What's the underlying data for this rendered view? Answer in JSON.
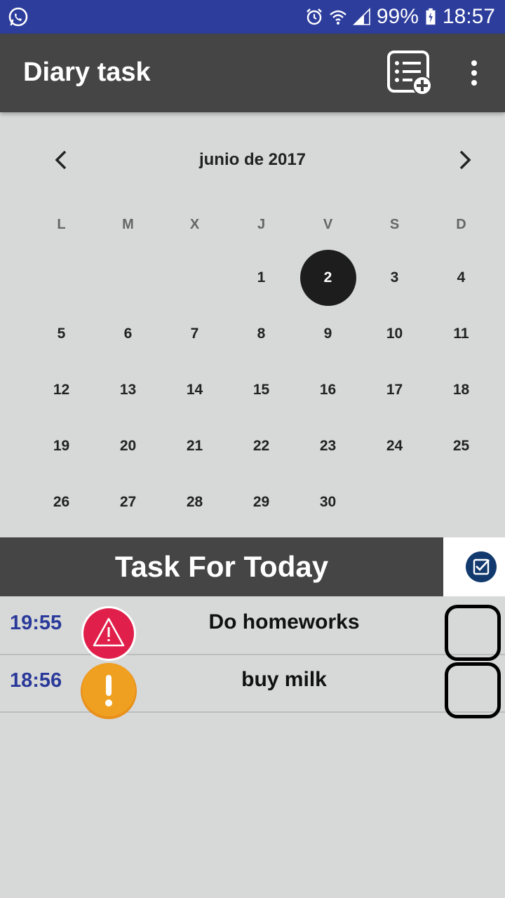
{
  "status_bar": {
    "battery": "99%",
    "time": "18:57",
    "icons": [
      "whatsapp-icon",
      "alarm-icon",
      "wifi-icon",
      "signal-icon",
      "battery-charging-icon"
    ]
  },
  "app_bar": {
    "title": "Diary task",
    "actions": [
      "add-task-icon",
      "overflow-menu-icon"
    ]
  },
  "calendar": {
    "month_label": "junio de 2017",
    "weekdays": [
      "L",
      "M",
      "X",
      "J",
      "V",
      "S",
      "D"
    ],
    "weeks": [
      [
        "",
        "",
        "",
        "1",
        "2",
        "3",
        "4"
      ],
      [
        "5",
        "6",
        "7",
        "8",
        "9",
        "10",
        "11"
      ],
      [
        "12",
        "13",
        "14",
        "15",
        "16",
        "17",
        "18"
      ],
      [
        "19",
        "20",
        "21",
        "22",
        "23",
        "24",
        "25"
      ],
      [
        "26",
        "27",
        "28",
        "29",
        "30",
        "",
        ""
      ]
    ],
    "selected_day": "2",
    "selected_color": "#1d1d1d"
  },
  "tasks_section": {
    "title": "Task For Today",
    "action_icon": "checklist-icon"
  },
  "tasks": [
    {
      "time": "19:55",
      "title": "Do homeworks",
      "priority_icon": "warning-triangle-icon",
      "priority_color": "#e0204a",
      "checked": false
    },
    {
      "time": "18:56",
      "title": "buy milk",
      "priority_icon": "exclamation-icon",
      "priority_color": "#f0a020",
      "checked": false
    }
  ],
  "colors": {
    "status_bar": "#2d3d9c",
    "app_bar": "#454545",
    "background": "#d7d8d8",
    "time_text": "#2a3a9a"
  }
}
